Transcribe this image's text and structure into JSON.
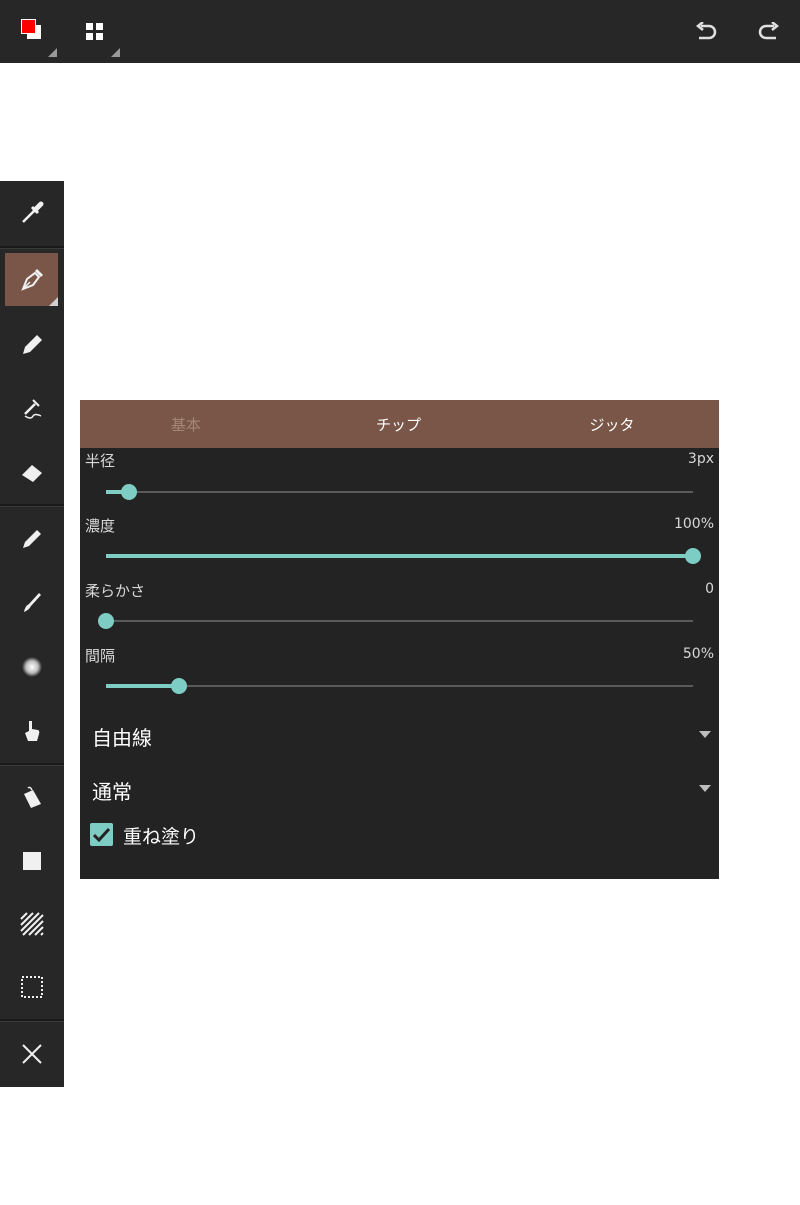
{
  "topbar": {
    "colors": {
      "primary": "#ff0000",
      "secondary": "#ffffff"
    },
    "icons": [
      "color-picker-icon",
      "layers-grid-icon",
      "undo-icon",
      "redo-icon"
    ]
  },
  "toolbar": {
    "active_tool": "pen",
    "tools": [
      "eyedropper",
      "pen",
      "pencil",
      "airbrush",
      "eraser",
      "brush",
      "paintbrush",
      "blur",
      "finger",
      "bucket",
      "fill-rect",
      "pattern",
      "selection",
      "close"
    ]
  },
  "panel": {
    "tabs": [
      {
        "label": "基本",
        "selected": true
      },
      {
        "label": "チップ",
        "selected": false
      },
      {
        "label": "ジッタ",
        "selected": false
      }
    ],
    "sliders": [
      {
        "label": "半径",
        "value": "3px",
        "fraction": 0.04
      },
      {
        "label": "濃度",
        "value": "100%",
        "fraction": 1.0
      },
      {
        "label": "柔らかさ",
        "value": "0",
        "fraction": 0.0
      },
      {
        "label": "間隔",
        "value": "50%",
        "fraction": 0.125
      }
    ],
    "stroke_mode": "自由線",
    "blend_mode": "通常",
    "overpaint_label": "重ね塗り",
    "overpaint_checked": true
  },
  "accent": "#7ecdc4",
  "active_color": "#7a5648"
}
